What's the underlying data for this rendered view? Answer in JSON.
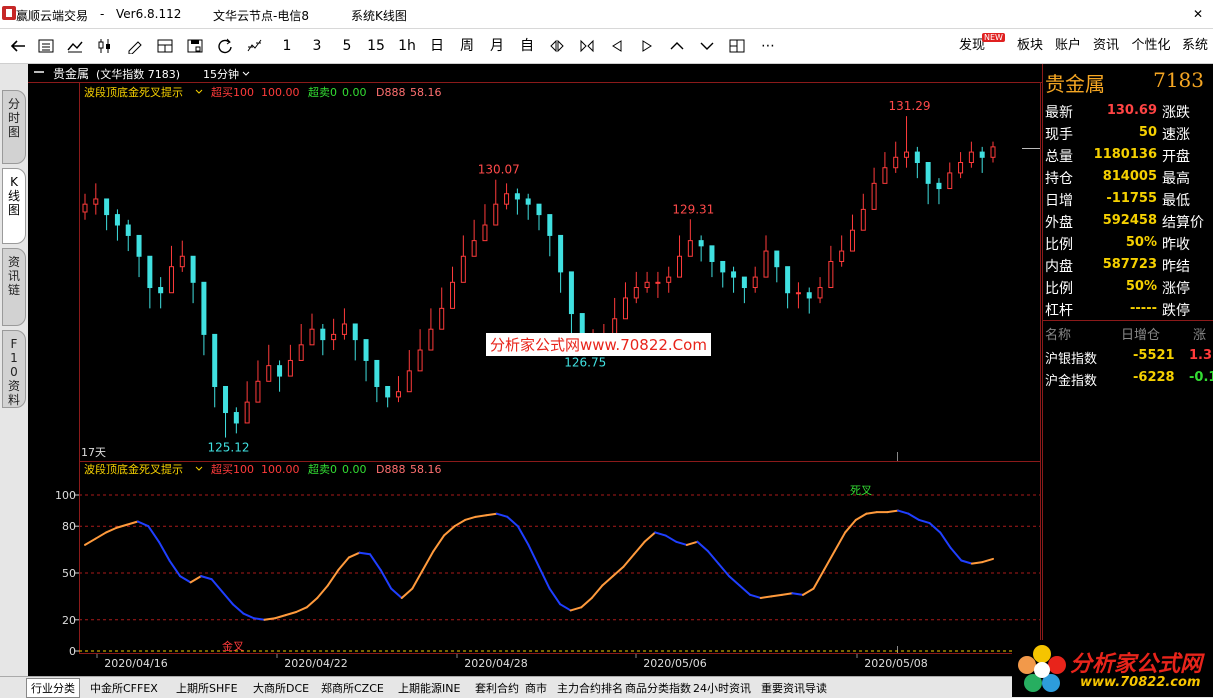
{
  "window": {
    "app_name": "赢顺云端交易",
    "dash": "-",
    "version": "Ver6.8.112",
    "server": "文华云节点-电信8",
    "view": "系统K线图"
  },
  "toolbar": {
    "periods": [
      "1",
      "3",
      "5",
      "15",
      "1h",
      "日",
      "周",
      "月",
      "自"
    ],
    "right_menu": [
      "发现",
      "板块",
      "账户",
      "资讯",
      "个性化",
      "系统"
    ],
    "new_badge": "NEW"
  },
  "side_tabs": [
    "分时图",
    "K线图",
    "资讯链",
    "F10资料"
  ],
  "chart_header": {
    "name": "贵金属",
    "index_label": "(文华指数  7183)",
    "period": "15分钟"
  },
  "main_panel": {
    "indicator_name": "波段顶底金死叉提示",
    "overbuy_label": "超买100",
    "overbuy_value": "100.00",
    "oversell_label": "超卖0",
    "oversell_value": "0.00",
    "d_label": "D888",
    "d_value": "58.16",
    "days_label": "17天"
  },
  "lower_panel": {
    "indicator_name": "波段顶底金死叉提示",
    "overbuy_label": "超买100",
    "overbuy_value": "100.00",
    "oversell_label": "超卖0",
    "oversell_value": "0.00",
    "d_label": "D888",
    "d_value": "58.16",
    "dead_cross_label": "死叉",
    "gold_cross_label": "金叉"
  },
  "x_dates": [
    "2020/04/16",
    "2020/04/22",
    "2020/04/28",
    "2020/05/06",
    "2020/05/08"
  ],
  "chart_data": [
    {
      "type": "candlestick",
      "title": "贵金属",
      "annotations": [
        {
          "label": "131.29",
          "value": 131.29,
          "kind": "high"
        },
        {
          "label": "130.07",
          "value": 130.07,
          "kind": "high"
        },
        {
          "label": "129.31",
          "value": 129.31,
          "kind": "high"
        },
        {
          "label": "126.75",
          "value": 126.75,
          "kind": "low"
        },
        {
          "label": "125.12",
          "value": 125.12,
          "kind": "low"
        }
      ],
      "ylim": [
        124.9,
        131.6
      ],
      "close": [
        129.6,
        129.7,
        129.4,
        129.2,
        129.0,
        128.6,
        128.0,
        127.9,
        128.4,
        128.6,
        128.1,
        127.1,
        126.1,
        125.6,
        125.4,
        125.8,
        126.2,
        126.5,
        126.3,
        126.6,
        126.9,
        127.2,
        127.0,
        127.1,
        127.3,
        127.0,
        126.6,
        126.1,
        125.9,
        126.0,
        126.4,
        126.8,
        127.2,
        127.6,
        128.1,
        128.6,
        128.9,
        129.2,
        129.6,
        129.8,
        129.7,
        129.6,
        129.4,
        129.0,
        128.3,
        127.5,
        126.9,
        126.9,
        127.0,
        127.4,
        127.8,
        128.0,
        128.1,
        128.1,
        128.2,
        128.6,
        128.9,
        128.8,
        128.5,
        128.3,
        128.2,
        128.0,
        128.2,
        128.7,
        128.4,
        127.9,
        127.9,
        127.8,
        128.0,
        128.5,
        128.7,
        129.1,
        129.5,
        130.0,
        130.3,
        130.5,
        130.6,
        130.4,
        130.0,
        129.9,
        130.2,
        130.4,
        130.6,
        130.5,
        130.7
      ],
      "high": [
        129.8,
        130.0,
        129.6,
        129.5,
        129.3,
        128.9,
        128.3,
        128.2,
        128.8,
        128.9,
        128.5,
        127.5,
        126.5,
        125.9,
        125.7,
        126.2,
        126.6,
        126.9,
        126.6,
        126.9,
        127.3,
        127.5,
        127.3,
        127.4,
        127.6,
        127.3,
        126.9,
        126.4,
        126.1,
        126.3,
        126.8,
        127.2,
        127.6,
        128.0,
        128.4,
        129.0,
        129.3,
        129.6,
        130.07,
        130.0,
        129.9,
        129.8,
        129.6,
        129.3,
        128.7,
        127.8,
        127.2,
        127.2,
        127.3,
        127.8,
        128.1,
        128.3,
        128.3,
        128.3,
        128.4,
        129.0,
        129.31,
        129.0,
        128.7,
        128.5,
        128.4,
        128.2,
        128.4,
        129.0,
        128.6,
        128.1,
        128.1,
        128.0,
        128.2,
        128.8,
        129.0,
        129.4,
        129.8,
        130.3,
        130.6,
        130.8,
        131.29,
        130.7,
        130.3,
        130.1,
        130.4,
        130.6,
        130.8,
        130.7,
        130.8
      ],
      "low": [
        129.3,
        129.4,
        129.1,
        128.9,
        128.7,
        128.2,
        127.6,
        127.6,
        128.1,
        128.3,
        127.7,
        126.7,
        125.7,
        125.12,
        125.2,
        125.5,
        125.9,
        126.2,
        126.0,
        126.3,
        126.6,
        126.9,
        126.7,
        126.8,
        127.0,
        126.6,
        126.2,
        125.8,
        125.7,
        125.8,
        126.1,
        126.5,
        126.9,
        127.3,
        127.8,
        128.3,
        128.6,
        128.9,
        129.3,
        129.5,
        129.4,
        129.3,
        129.1,
        128.6,
        127.9,
        127.1,
        126.75,
        126.7,
        126.8,
        127.1,
        127.5,
        127.7,
        127.9,
        127.8,
        127.9,
        128.3,
        128.6,
        128.5,
        128.2,
        128.0,
        127.9,
        127.7,
        127.9,
        128.4,
        128.1,
        127.6,
        127.6,
        127.5,
        127.7,
        128.2,
        128.4,
        128.8,
        129.2,
        129.7,
        130.0,
        130.2,
        130.3,
        130.1,
        129.6,
        129.6,
        129.9,
        130.1,
        130.3,
        130.2,
        130.4
      ]
    },
    {
      "type": "line",
      "title": "波段顶底金死叉提示",
      "ylim": [
        0,
        100
      ],
      "yticks": [
        0,
        20,
        50,
        80,
        100
      ],
      "values": [
        68,
        72,
        76,
        79,
        81,
        83,
        80,
        70,
        58,
        48,
        44,
        48,
        46,
        38,
        30,
        24,
        21,
        20,
        21,
        23,
        25,
        28,
        34,
        42,
        52,
        60,
        63,
        62,
        52,
        40,
        34,
        40,
        52,
        64,
        74,
        80,
        84,
        86,
        87,
        88,
        86,
        80,
        68,
        54,
        40,
        30,
        26,
        28,
        34,
        42,
        48,
        54,
        62,
        70,
        76,
        74,
        70,
        68,
        70,
        64,
        56,
        48,
        42,
        36,
        34,
        35,
        36,
        37,
        36,
        40,
        52,
        64,
        76,
        84,
        88,
        89,
        89,
        90,
        88,
        84,
        82,
        76,
        66,
        58,
        56,
        57,
        59
      ],
      "segment_colors": {
        "rising": "#ff9a3c",
        "falling": "#1f3fff"
      }
    }
  ],
  "quote": {
    "title": "贵金属",
    "code": "7183",
    "rows": [
      {
        "label": "最新",
        "value": "130.69",
        "color": "#ff4444",
        "label2": "涨跌"
      },
      {
        "label": "现手",
        "value": "50",
        "color": "#f5d000",
        "label2": "速涨"
      },
      {
        "label": "总量",
        "value": "1180136",
        "color": "#f5d000",
        "label2": "开盘"
      },
      {
        "label": "持仓",
        "value": "814005",
        "color": "#f5d000",
        "label2": "最高"
      },
      {
        "label": "日增",
        "value": "-11755",
        "color": "#f5d000",
        "label2": "最低"
      },
      {
        "label": "外盘",
        "value": "592458",
        "color": "#f5d000",
        "label2": "结算价"
      },
      {
        "label": "比例",
        "value": "50%",
        "color": "#f5d000",
        "label2": "昨收"
      },
      {
        "label": "内盘",
        "value": "587723",
        "color": "#f5d000",
        "label2": "昨结"
      },
      {
        "label": "比例",
        "value": "50%",
        "color": "#f5d000",
        "label2": "涨停"
      },
      {
        "label": "杠杆",
        "value": "-----",
        "color": "#f5d000",
        "label2": "跌停"
      }
    ],
    "index_header": [
      "名称",
      "日增仓",
      "涨"
    ],
    "indices": [
      {
        "name": "沪银指数",
        "inc": "-5521",
        "chg": "1.3"
      },
      {
        "name": "沪金指数",
        "inc": "-6228",
        "chg": "-0.1"
      }
    ]
  },
  "bottom_tabs": [
    "行业分类",
    "中金所CFFEX",
    "上期所SHFE",
    "大商所DCE",
    "郑商所CZCE",
    "上期能源INE",
    "套利合约",
    "商市",
    "主力合约排名",
    "商品分类指数",
    "24小时资讯",
    "重要资讯导读"
  ],
  "watermark": "分析家公式网www.70822.Com",
  "logo": {
    "line1": "分析家公式网",
    "line2": "www.70822.com"
  }
}
